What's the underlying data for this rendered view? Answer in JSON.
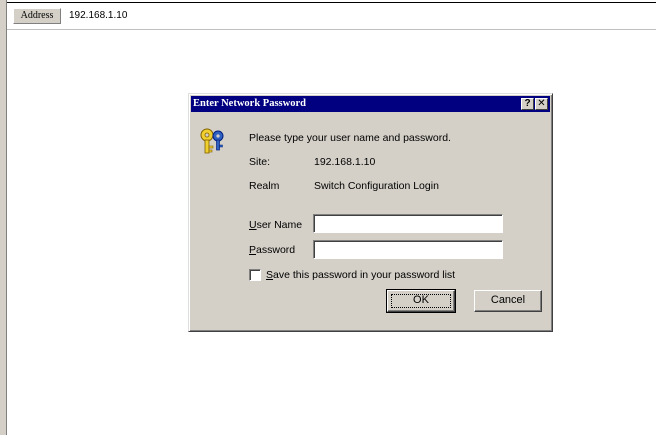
{
  "browser": {
    "address_label": "Address",
    "address_value": "192.168.1.10"
  },
  "dialog": {
    "title": "Enter Network Password",
    "help_button": "?",
    "close_button": "✕",
    "prompt": "Please type your user name and password.",
    "site_label": "Site:",
    "site_value": "192.168.1.10",
    "realm_label": "Realm",
    "realm_value": "Switch Configuration Login",
    "username_label_u": "U",
    "username_label_rest": "ser Name",
    "username_value": "",
    "password_label_p": "P",
    "password_label_rest": "assword",
    "password_value": "",
    "save_checked": false,
    "save_label_s": "S",
    "save_label_rest": "ave this password in your password list",
    "ok_label": "OK",
    "cancel_label": "Cancel",
    "colors": {
      "titlebar": "#000080",
      "face": "#d4d0c8"
    },
    "icon": "key-icon"
  }
}
